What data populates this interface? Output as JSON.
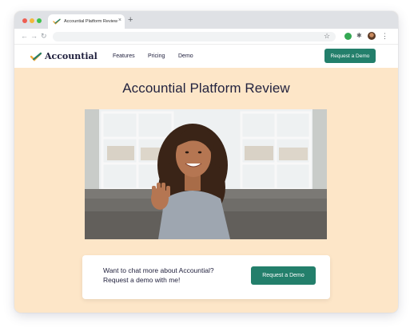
{
  "browser": {
    "tab_title": "Accountial Platform Review",
    "tab_close_icon": "×",
    "new_tab_icon": "+",
    "back_icon": "←",
    "forward_icon": "→",
    "reload_icon": "↻",
    "bookmark_icon": "☆",
    "extension_icon": "✱",
    "menu_icon": "⋮"
  },
  "site": {
    "logo_text": "Accountial",
    "nav": [
      {
        "label": "Features"
      },
      {
        "label": "Pricing"
      },
      {
        "label": "Demo"
      }
    ],
    "header_cta": "Request a Demo"
  },
  "main": {
    "title": "Accountial Platform Review",
    "cta": {
      "line1": "Want to chat more about Accountial?",
      "line2": "Request a demo with me!",
      "button": "Request a Demo"
    }
  },
  "colors": {
    "accent": "#237f6b",
    "page_background": "#fde6c8",
    "heading": "#23233f"
  }
}
